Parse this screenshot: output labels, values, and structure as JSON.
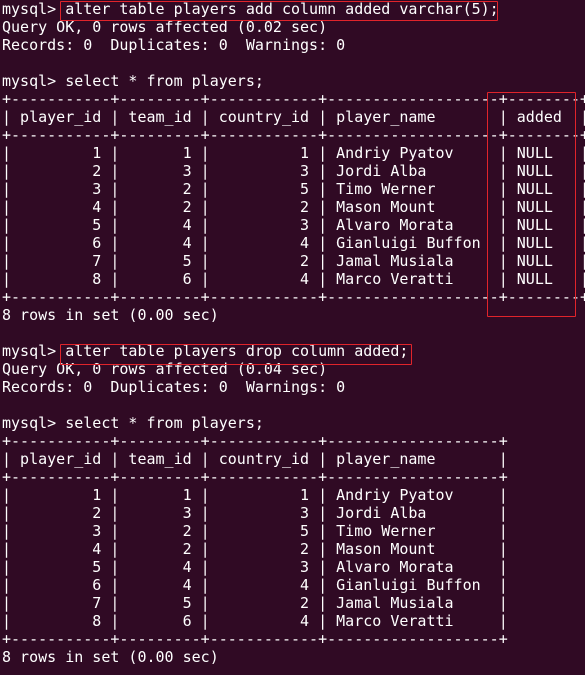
{
  "theme": {
    "background": "#300a24",
    "text": "#ffffff",
    "highlight_border": "#e0242b"
  },
  "session": {
    "prompt": "mysql>",
    "cmd1": "alter table players add column added varchar(5);",
    "cmd1_status": "Query OK, 0 rows affected (0.02 sec)",
    "cmd1_records": "Records: 0  Duplicates: 0  Warnings: 0",
    "cmd2": "select * from players;",
    "table1": {
      "border": "+-----------+---------+------------+-------------------+--------+",
      "header": "| player_id | team_id | country_id | player_name       | added  |",
      "rows": [
        "|         1 |       1 |          1 | Andriy Pyatov     | NULL   |",
        "|         2 |       3 |          3 | Jordi Alba        | NULL   |",
        "|         3 |       2 |          5 | Timo Werner       | NULL   |",
        "|         4 |       2 |          2 | Mason Mount       | NULL   |",
        "|         5 |       4 |          3 | Alvaro Morata     | NULL   |",
        "|         6 |       4 |          4 | Gianluigi Buffon  | NULL   |",
        "|         7 |       5 |          2 | Jamal Musiala     | NULL   |",
        "|         8 |       6 |          4 | Marco Veratti     | NULL   |"
      ]
    },
    "cmd2_result": "8 rows in set (0.00 sec)",
    "cmd3": "alter table players drop column added;",
    "cmd3_status": "Query OK, 0 rows affected (0.04 sec)",
    "cmd3_records": "Records: 0  Duplicates: 0  Warnings: 0",
    "cmd4": "select * from players;",
    "table2": {
      "border": "+-----------+---------+------------+-------------------+",
      "header": "| player_id | team_id | country_id | player_name       |",
      "rows": [
        "|         1 |       1 |          1 | Andriy Pyatov     |",
        "|         2 |       3 |          3 | Jordi Alba        |",
        "|         3 |       2 |          5 | Timo Werner       |",
        "|         4 |       2 |          2 | Mason Mount       |",
        "|         5 |       4 |          3 | Alvaro Morata     |",
        "|         6 |       4 |          4 | Gianluigi Buffon  |",
        "|         7 |       5 |          2 | Jamal Musiala     |",
        "|         8 |       6 |          4 | Marco Veratti     |"
      ]
    },
    "cmd4_result": "8 rows in set (0.00 sec)"
  }
}
